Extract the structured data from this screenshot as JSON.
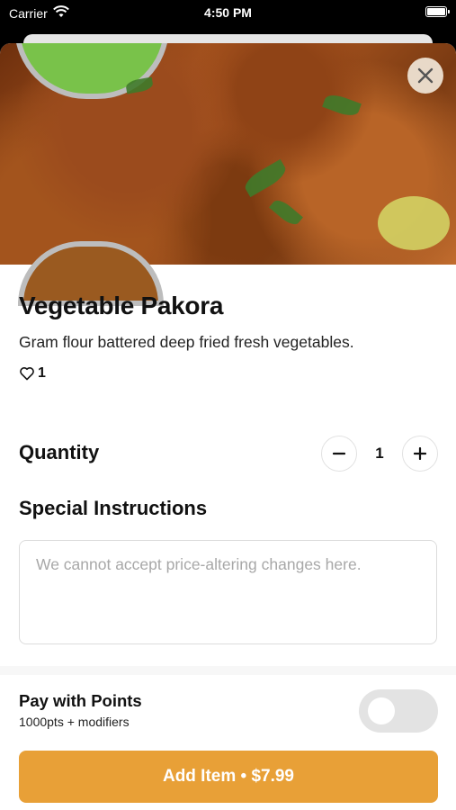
{
  "status_bar": {
    "carrier": "Carrier",
    "time": "4:50 PM",
    "icons": [
      "wifi-icon",
      "battery-icon"
    ]
  },
  "item": {
    "title": "Vegetable Pakora",
    "description": "Gram flour battered deep fried fresh vegetables.",
    "likes_count": "1"
  },
  "quantity": {
    "label": "Quantity",
    "value": "1"
  },
  "instructions": {
    "label": "Special Instructions",
    "placeholder": "We cannot accept price-altering changes here.",
    "value": ""
  },
  "points": {
    "title": "Pay with Points",
    "subtitle": "1000pts + modifiers",
    "enabled": false
  },
  "add_button": {
    "label": "Add Item • $7.99"
  },
  "colors": {
    "accent": "#e8a037",
    "toggle_off": "#e3e3e3",
    "close_bg": "#e8d9c8"
  }
}
